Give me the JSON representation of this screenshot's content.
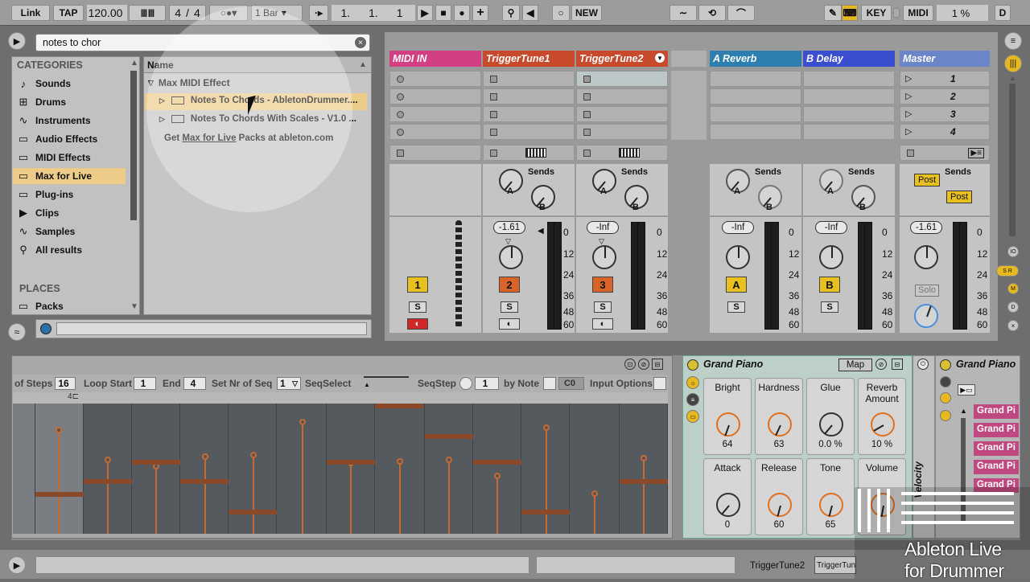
{
  "transport": {
    "link": "Link",
    "tap": "TAP",
    "tempo": "120.00",
    "sig_num": "4",
    "sig_den": "4",
    "quant": "1 Bar",
    "pos1": "1.",
    "pos2": "1.",
    "pos3": "1",
    "new": "NEW",
    "key": "KEY",
    "midi": "MIDI",
    "cpu": "1 %",
    "d": "D"
  },
  "browser": {
    "search_value": "notes to chor",
    "categories_header": "CATEGORIES",
    "name_header": "Name",
    "categories": [
      "Sounds",
      "Drums",
      "Instruments",
      "Audio Effects",
      "MIDI Effects",
      "Max for Live",
      "Plug-ins",
      "Clips",
      "Samples",
      "All results"
    ],
    "places_header": "PLACES",
    "places": [
      "Packs"
    ],
    "folder": "Max MIDI Effect",
    "items": [
      "Notes To Chords - AbletonDrummer....",
      "Notes To Chords With Scales - V1.0 ..."
    ],
    "promo_prefix": "Get ",
    "promo_link": "Max for Live",
    "promo_mid": " Packs at ",
    "promo_site": "ableton.com"
  },
  "tracks": [
    {
      "name": "MIDI IN",
      "color": "#d23f82",
      "num": "1",
      "num_color": "#e8c020"
    },
    {
      "name": "TriggerTune1",
      "color": "#c84a2c",
      "num": "2",
      "num_color": "#d8642a",
      "vol": "-1.61"
    },
    {
      "name": "TriggerTune2",
      "color": "#c84a2c",
      "num": "3",
      "num_color": "#d8642a",
      "vol": "-Inf"
    },
    {
      "name": "A Reverb",
      "color": "#2d7fb0",
      "num": "A",
      "num_color": "#e8c020",
      "vol": "-Inf"
    },
    {
      "name": "B Delay",
      "color": "#3a4ed0",
      "num": "B",
      "num_color": "#e8c020",
      "vol": "-Inf"
    },
    {
      "name": "Master",
      "color": "#6a86c8",
      "vol": "-1.61"
    }
  ],
  "mixer": {
    "sends": "Sends",
    "knob_a": "A",
    "knob_b": "B",
    "post": "Post",
    "solo": "Solo",
    "s": "S",
    "meter_ticks": [
      "0",
      "12",
      "24",
      "36",
      "48",
      "60"
    ],
    "scenes": [
      "1",
      "2",
      "3",
      "4"
    ]
  },
  "sequencer": {
    "of_steps": "of Steps",
    "steps": "16",
    "loop_start": "Loop Start",
    "loop_start_val": "1",
    "end": "End",
    "end_val": "4",
    "set_nr": "Set Nr of Seq",
    "set_nr_val": "1",
    "seq_select": "SeqSelect",
    "seq_step": "SeqStep",
    "seq_step_val": "1",
    "by_note": "by Note",
    "note_val": "C0",
    "input_options": "Input Options",
    "marker": "4"
  },
  "rack": {
    "title": "Grand Piano",
    "map": "Map",
    "macros": [
      {
        "label": "Bright",
        "value": "64"
      },
      {
        "label": "Hardness",
        "value": "63"
      },
      {
        "label": "Glue",
        "value": "0.0 %"
      },
      {
        "label": "Reverb Amount",
        "value": "10 %"
      },
      {
        "label": "Attack",
        "value": "0"
      },
      {
        "label": "Release",
        "value": "60"
      },
      {
        "label": "Tone",
        "value": "65"
      },
      {
        "label": "Volume",
        "value": ""
      }
    ],
    "velocity": "Velocity"
  },
  "rack2": {
    "title": "Grand Piano",
    "chains": [
      "Grand Pi",
      "Grand Pi",
      "Grand Pi",
      "Grand Pi",
      "Grand Pi"
    ]
  },
  "statusbar": {
    "track": "TriggerTune2",
    "device": "TriggerTun"
  },
  "watermark": {
    "line1": "Ableton Live",
    "line2": "for Drummer"
  }
}
